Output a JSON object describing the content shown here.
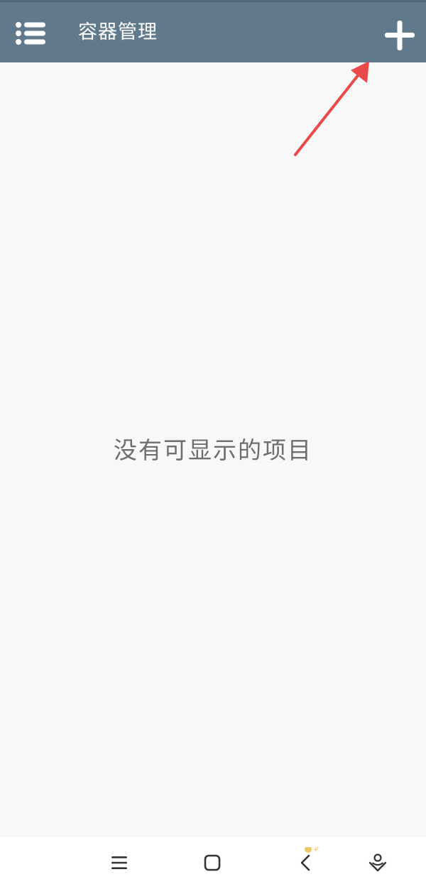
{
  "app_bar": {
    "title": "容器管理",
    "menu_icon": "list-menu-icon",
    "add_icon": "plus-icon",
    "background_color": "#607a8b"
  },
  "main": {
    "empty_message": "没有可显示的项目"
  },
  "annotation": {
    "icon": "red-arrow-pointing-to-add-button",
    "color": "#e84a4a"
  },
  "nav_bar": {
    "buttons": [
      {
        "icon": "recent-apps-icon"
      },
      {
        "icon": "home-icon"
      },
      {
        "icon": "back-icon"
      },
      {
        "icon": "assistant-icon"
      }
    ]
  }
}
